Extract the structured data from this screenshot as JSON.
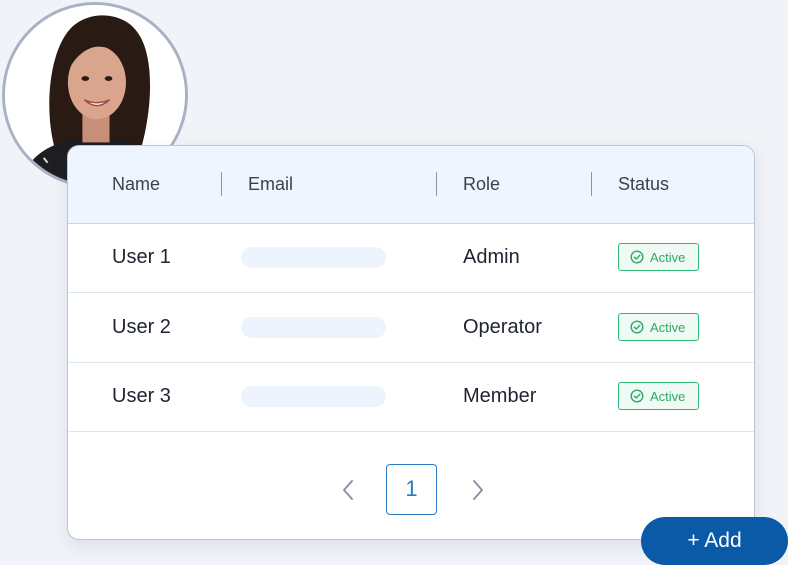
{
  "table": {
    "headers": {
      "name": "Name",
      "email": "Email",
      "role": "Role",
      "status": "Status"
    },
    "rows": [
      {
        "name": "User 1",
        "role": "Admin",
        "status": "Active"
      },
      {
        "name": "User 2",
        "role": "Operator",
        "status": "Active"
      },
      {
        "name": "User 3",
        "role": "Member",
        "status": "Active"
      }
    ]
  },
  "pagination": {
    "current_page": "1"
  },
  "actions": {
    "add_label": "+ Add"
  },
  "icons": {
    "status": "check-circle-icon",
    "prev": "chevron-left-icon",
    "next": "chevron-right-icon"
  },
  "colors": {
    "background": "#f1f3f8",
    "header_bg": "#eef5ff",
    "active_green": "#2fb873",
    "primary_blue": "#0a5aa8",
    "pager_blue": "#2b7bc4"
  }
}
